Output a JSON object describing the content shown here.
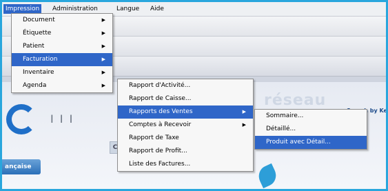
{
  "menubar": {
    "items": [
      "Impression",
      "Administration",
      "Langue",
      "Aide"
    ]
  },
  "menu1": {
    "items": [
      {
        "label": "Document",
        "arrow": "▶"
      },
      {
        "label": "Étiquette",
        "arrow": "▶"
      },
      {
        "label": "Patient",
        "arrow": "▶"
      },
      {
        "label": "Facturation",
        "arrow": "▶"
      },
      {
        "label": "Inventaire",
        "arrow": "▶"
      },
      {
        "label": "Agenda",
        "arrow": "▶"
      }
    ]
  },
  "menu2": {
    "items": [
      {
        "label": "Rapport d'Activité..."
      },
      {
        "label": "Rapport de Caisse..."
      },
      {
        "label": "Rapports des Ventes",
        "arrow": "▶"
      },
      {
        "label": "Comptes à Recevoir",
        "arrow": "▶"
      },
      {
        "label": "Rapport de Taxe"
      },
      {
        "label": "Rapport de Profit..."
      },
      {
        "label": "Liste des Factures..."
      }
    ]
  },
  "menu3": {
    "items": [
      "Sommaire...",
      "Détaillé...",
      "Produit avec Détail..."
    ]
  },
  "background": {
    "tab_label": "C",
    "lang_button": "ançaise",
    "search_link": "Search by Ke",
    "brand_text": "réseau",
    "bars_text": "I I I"
  },
  "colors": {
    "frame": "#29a6dd",
    "selection": "#2f66c8",
    "menu_bg": "#f7f7f7"
  }
}
